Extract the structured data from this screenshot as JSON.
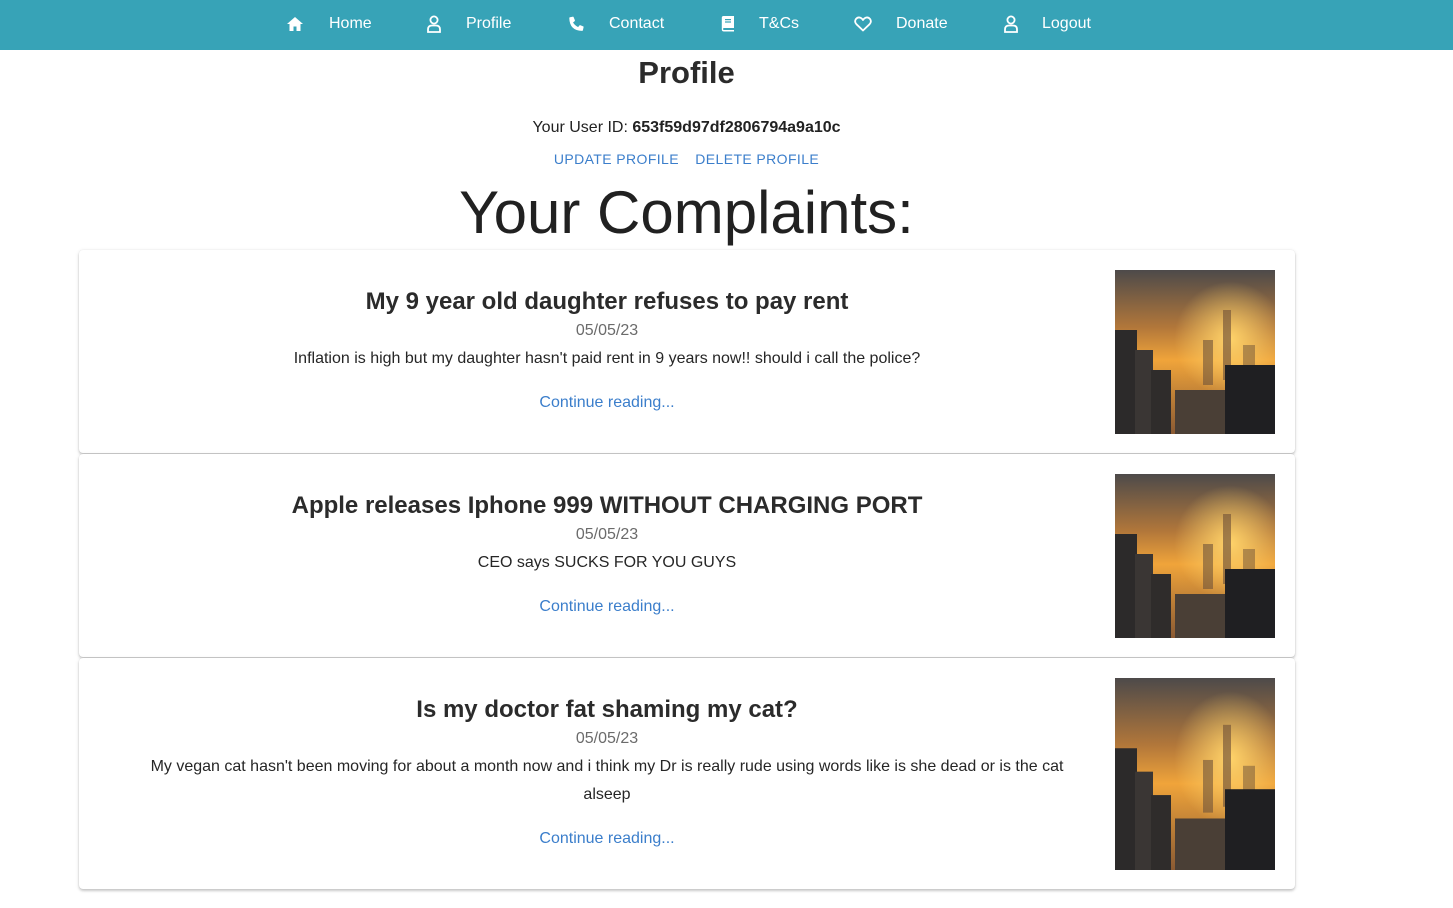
{
  "nav": {
    "items": [
      {
        "label": "Home",
        "icon": "home-icon"
      },
      {
        "label": "Profile",
        "icon": "user-icon"
      },
      {
        "label": "Contact",
        "icon": "phone-icon"
      },
      {
        "label": "T&Cs",
        "icon": "book-icon"
      },
      {
        "label": "Donate",
        "icon": "heart-icon"
      },
      {
        "label": "Logout",
        "icon": "user-icon"
      }
    ],
    "background": "#37a3b7"
  },
  "profile": {
    "title": "Profile",
    "user_id_label": "Your User ID: ",
    "user_id": "653f59d97df2806794a9a10c",
    "update_label": "Update Profile",
    "delete_label": "Delete Profile"
  },
  "complaints": {
    "heading": "Your Complaints:",
    "items": [
      {
        "title": "My 9 year old daughter refuses to pay rent",
        "date": "05/05/23",
        "text": "Inflation is high but my daughter hasn't paid rent in 9 years now!! should i call the police?",
        "link": "Continue reading..."
      },
      {
        "title": "Apple releases Iphone 999 WITHOUT CHARGING PORT",
        "date": "05/05/23",
        "text": "CEO says SUCKS FOR YOU GUYS",
        "link": "Continue reading..."
      },
      {
        "title": "Is my doctor fat shaming my cat?",
        "date": "05/05/23",
        "text": "My vegan cat hasn't been moving for about a month now and i think my Dr is really rude using words like is she dead or is the cat alseep",
        "link": "Continue reading..."
      }
    ]
  },
  "colors": {
    "accent": "#37a3b7",
    "link": "#3b7ecb"
  }
}
